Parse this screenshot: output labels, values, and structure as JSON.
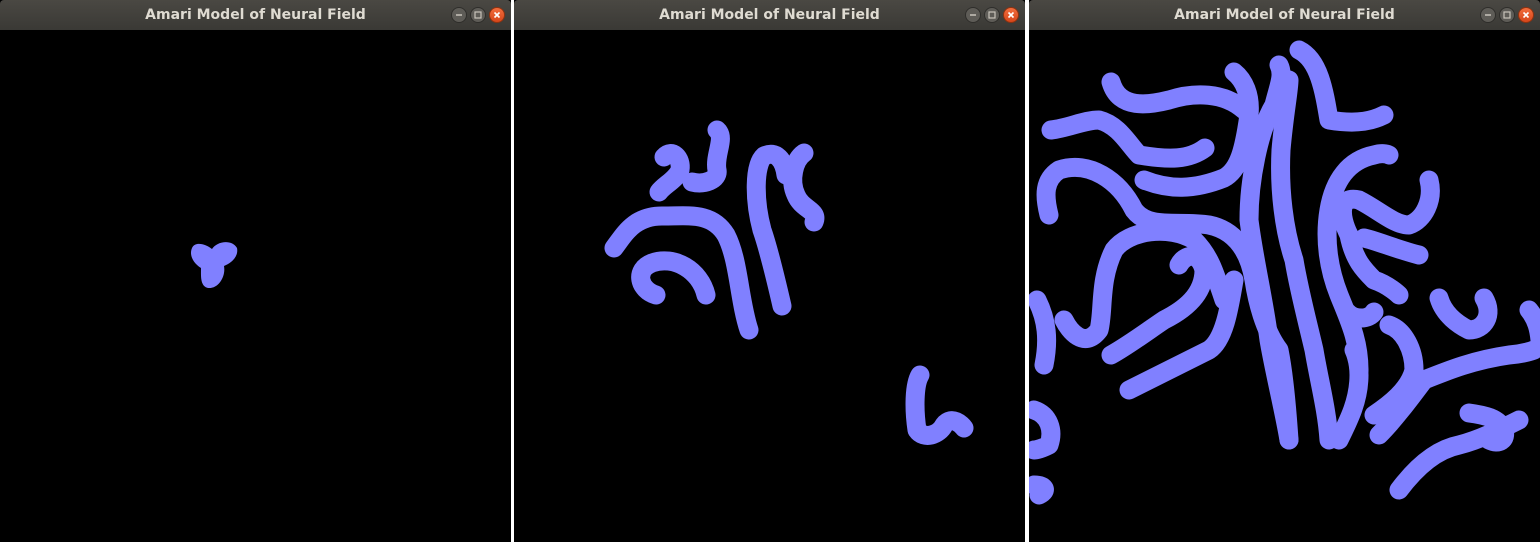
{
  "windows": [
    {
      "title": "Amari Model of Neural Field"
    },
    {
      "title": "Amari Model of Neural Field"
    },
    {
      "title": "Amari Model of Neural Field"
    }
  ],
  "icons": {
    "minimize": "minimize-icon",
    "maximize": "maximize-icon",
    "close": "close-icon"
  },
  "colors": {
    "activity": "#8080ff",
    "field_background": "#000000",
    "titlebar": "#3c3b37",
    "close_button": "#e95420"
  }
}
